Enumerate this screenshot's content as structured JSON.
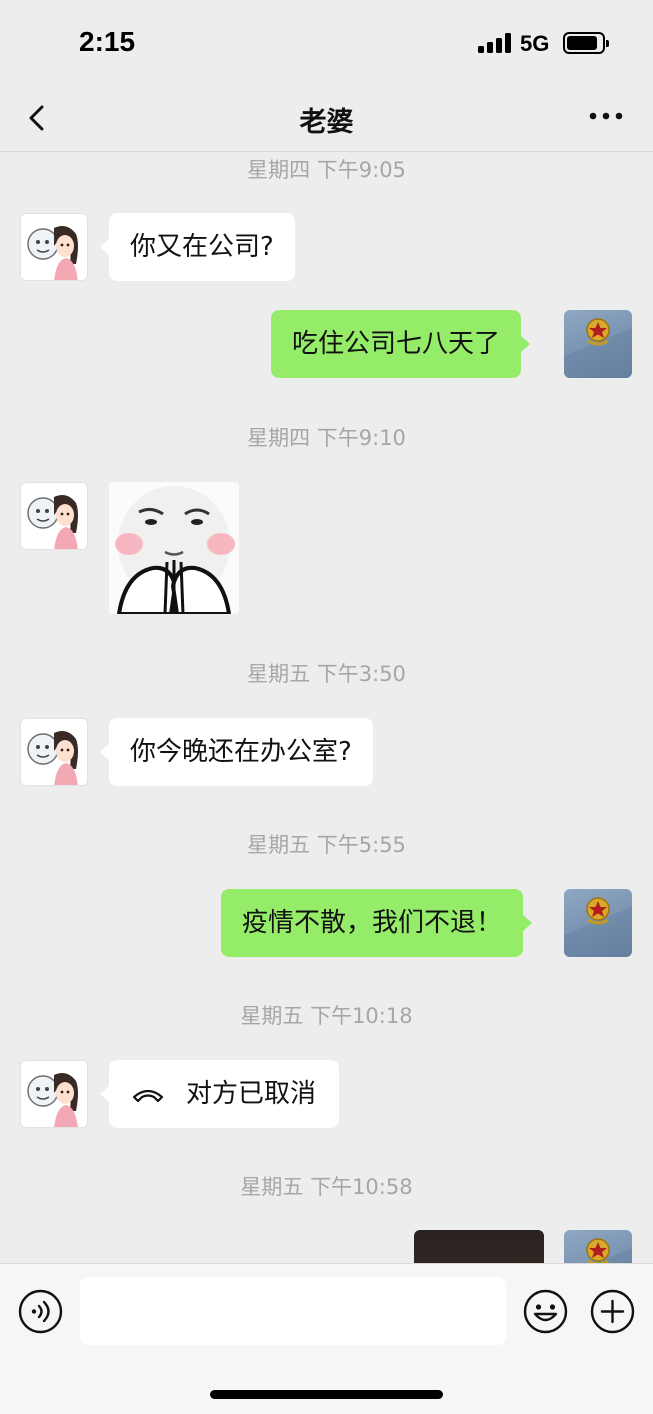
{
  "status_bar": {
    "time": "2:15",
    "network": "5G"
  },
  "header": {
    "title": "老婆",
    "back_icon": "chevron-left-icon",
    "more_icon": "more-horizontal-icon"
  },
  "messages": [
    {
      "type": "timestamp",
      "text": "星期四 下午9:05"
    },
    {
      "type": "text",
      "from": "contact",
      "text": "你又在公司?"
    },
    {
      "type": "text",
      "from": "me",
      "text": "吃住公司七八天了"
    },
    {
      "type": "timestamp",
      "text": "星期四 下午9:10"
    },
    {
      "type": "sticker",
      "from": "contact",
      "icon": "praying-meme-sticker"
    },
    {
      "type": "timestamp",
      "text": "星期五 下午3:50"
    },
    {
      "type": "text",
      "from": "contact",
      "text": "你今晚还在办公室?"
    },
    {
      "type": "timestamp",
      "text": "星期五 下午5:55"
    },
    {
      "type": "text",
      "from": "me",
      "text": "疫情不散，我们不退！"
    },
    {
      "type": "timestamp",
      "text": "星期五 下午10:18"
    },
    {
      "type": "call",
      "from": "contact",
      "icon": "phone-hangup-icon",
      "text": "对方已取消"
    },
    {
      "type": "timestamp",
      "text": "星期五 下午10:58"
    },
    {
      "type": "image",
      "from": "me"
    }
  ],
  "input_bar": {
    "message_value": "",
    "voice_icon": "voice-icon",
    "emoji_icon": "emoji-icon",
    "plus_icon": "plus-icon"
  },
  "colors": {
    "chat_background": "#ededed",
    "my_bubble": "#95ec69",
    "contact_bubble": "#ffffff",
    "timestamp_text": "#a6a6a6"
  }
}
